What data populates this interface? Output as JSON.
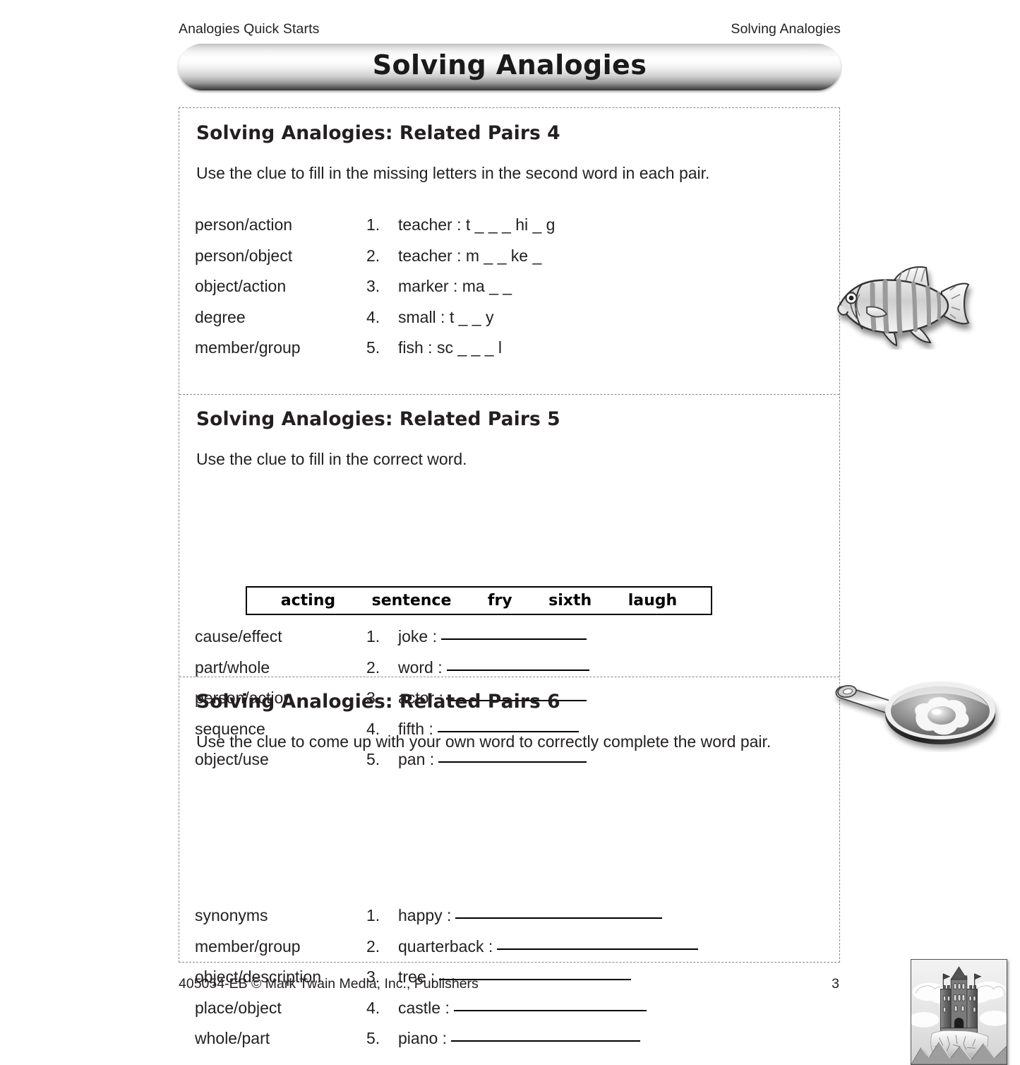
{
  "header": {
    "left": "Analogies Quick Starts",
    "right": "Solving Analogies"
  },
  "banner": {
    "title": "Solving Analogies"
  },
  "sections": [
    {
      "title": "Solving Analogies: Related Pairs 4",
      "instruction": "Use the clue to fill in the missing letters in the second word in each pair.",
      "rows": [
        {
          "clue": "person/action",
          "num": "1.",
          "prompt": "teacher : t _ _ _ hi _ g"
        },
        {
          "clue": "person/object",
          "num": "2.",
          "prompt": "teacher : m _ _ ke _"
        },
        {
          "clue": "object/action",
          "num": "3.",
          "prompt": "marker : ma _ _"
        },
        {
          "clue": "degree",
          "num": "4.",
          "prompt": "small : t _ _ y"
        },
        {
          "clue": "member/group",
          "num": "5.",
          "prompt": "fish : sc _ _ _ l"
        }
      ],
      "art": "fish-clipart"
    },
    {
      "title": "Solving Analogies: Related Pairs 5",
      "instruction": "Use the clue to fill in the correct word.",
      "word_bank": [
        "acting",
        "sentence",
        "fry",
        "sixth",
        "laugh"
      ],
      "rows": [
        {
          "clue": "cause/effect",
          "num": "1.",
          "prompt": "joke :",
          "blank_width": 206
        },
        {
          "clue": "part/whole",
          "num": "2.",
          "prompt": "word :",
          "blank_width": 202
        },
        {
          "clue": "person/action",
          "num": "3.",
          "prompt": "actor :",
          "blank_width": 197
        },
        {
          "clue": "sequence",
          "num": "4.",
          "prompt": "fifth :",
          "blank_width": 200
        },
        {
          "clue": "object/use",
          "num": "5.",
          "prompt": "pan :",
          "blank_width": 210
        }
      ],
      "art": "frying-pan-with-egg-clipart"
    },
    {
      "title": "Solving Analogies: Related Pairs 6",
      "instruction": "Use the clue to come up with your own word to correctly complete the word pair.",
      "rows": [
        {
          "clue": "synonyms",
          "num": "1.",
          "prompt": "happy :",
          "blank_width": 293
        },
        {
          "clue": "member/group",
          "num": "2.",
          "prompt": "quarterback :",
          "blank_width": 285
        },
        {
          "clue": "object/description",
          "num": "3.",
          "prompt": "tree :",
          "blank_width": 272
        },
        {
          "clue": "place/object",
          "num": "4.",
          "prompt": "castle :",
          "blank_width": 273
        },
        {
          "clue": "whole/part",
          "num": "5.",
          "prompt": "piano :",
          "blank_width": 268
        }
      ],
      "art": "castle-on-cliff-clipart"
    }
  ],
  "footer": {
    "credit": "405054-EB  © Mark Twain Media, Inc., Publishers",
    "page_number": "3"
  },
  "colors": {
    "text": "#231f20",
    "rule": "#000000",
    "dashed_border": "#8a8a8a",
    "page_background": "#ffffff"
  }
}
